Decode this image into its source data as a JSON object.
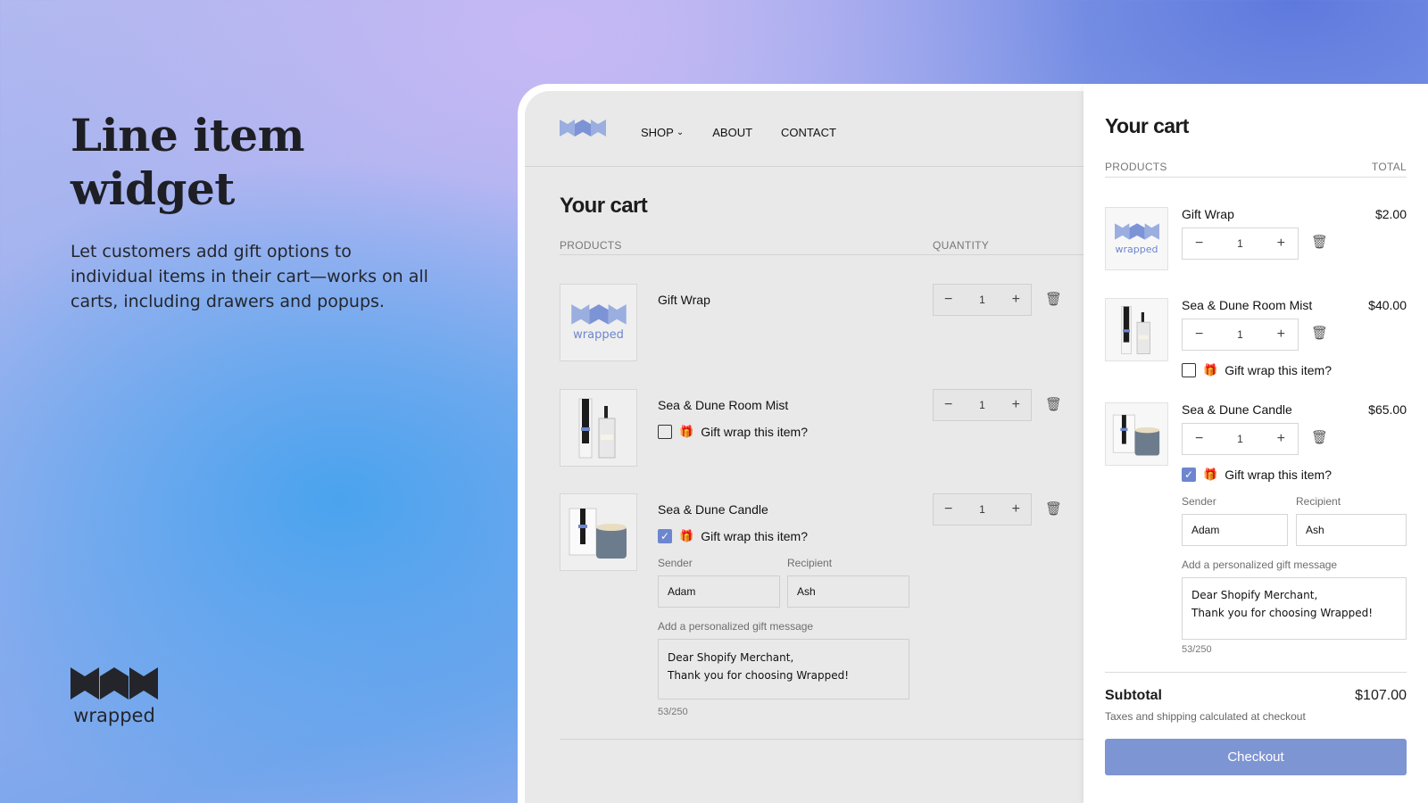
{
  "hero": {
    "title_line1": "Line item",
    "title_line2": "widget",
    "description": "Let customers add gift options to individual items in their cart—works on all carts, including drawers and popups.",
    "brand_name": "wrapped"
  },
  "store": {
    "nav": {
      "shop": "SHOP",
      "about": "ABOUT",
      "contact": "CONTACT"
    },
    "cart_title": "Your cart",
    "col_products": "PRODUCTS",
    "col_quantity": "QUANTITY",
    "items": [
      {
        "name": "Gift Wrap",
        "qty": "1",
        "thumb_label": "wrapped"
      },
      {
        "name": "Sea & Dune Room Mist",
        "qty": "1",
        "gift_label": "Gift wrap this item?",
        "gift_checked": false
      },
      {
        "name": "Sea & Dune Candle",
        "qty": "1",
        "gift_label": "Gift wrap this item?",
        "gift_checked": true,
        "sender_label": "Sender",
        "sender_value": "Adam",
        "recipient_label": "Recipient",
        "recipient_value": "Ash",
        "message_label": "Add a personalized gift message",
        "message_line1": "Dear Shopify Merchant,",
        "message_line2": "Thank you for choosing Wrapped!",
        "counter": "53/250"
      }
    ]
  },
  "drawer": {
    "title": "Your cart",
    "col_products": "PRODUCTS",
    "col_total": "TOTAL",
    "items": [
      {
        "name": "Gift Wrap",
        "price": "$2.00",
        "qty": "1",
        "thumb_label": "wrapped"
      },
      {
        "name": "Sea & Dune Room Mist",
        "price": "$40.00",
        "qty": "1",
        "gift_label": "Gift wrap this item?",
        "gift_checked": false
      },
      {
        "name": "Sea & Dune Candle",
        "price": "$65.00",
        "qty": "1",
        "gift_label": "Gift wrap this item?",
        "gift_checked": true,
        "sender_label": "Sender",
        "sender_value": "Adam",
        "recipient_label": "Recipient",
        "recipient_value": "Ash",
        "message_label": "Add a personalized gift message",
        "message_line1": "Dear Shopify Merchant,",
        "message_line2": "Thank you for choosing Wrapped!",
        "counter": "53/250"
      }
    ],
    "subtotal_label": "Subtotal",
    "subtotal_value": "$107.00",
    "taxes_note": "Taxes and shipping calculated at checkout",
    "checkout_label": "Checkout"
  },
  "icons": {
    "minus": "−",
    "plus": "+",
    "trash": "🗑",
    "gift": "🎁",
    "check": "✓",
    "chevron": "⌄"
  },
  "colors": {
    "accent": "#6d86cf",
    "checkout": "#7e95d3"
  }
}
